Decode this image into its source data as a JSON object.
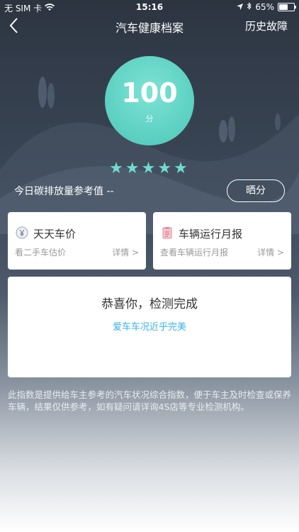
{
  "status_bar": {
    "carrier": "无 SIM 卡",
    "time": "15:16",
    "battery_text": "65%",
    "battery_level": 0.65
  },
  "nav": {
    "title": "汽车健康档案",
    "history_label": "历史故障"
  },
  "score": {
    "value": "100",
    "unit": "分",
    "stars": 5,
    "star_color": "#6fdcd0"
  },
  "carbon_text": "今日碳排放量参考值 --",
  "share_label": "晒分",
  "cards": [
    {
      "title": "天天车价",
      "subtitle": "看二手车估价",
      "detail": "详情 >"
    },
    {
      "title": "车辆运行月报",
      "subtitle": "查看车辆运行月报",
      "detail": "详情 >"
    }
  ],
  "result": {
    "title": "恭喜你，检测完成",
    "subtitle": "爱车车况近乎完美"
  },
  "disclaimer": "此指数是提供给车主参考的汽车状况综合指数，便于车主及时检查或保养车辆，结果仅供参考，如有疑问请详询4S店等专业检测机构。",
  "colors": {
    "accent": "#5fd2c4",
    "link": "#3ab3e8"
  }
}
